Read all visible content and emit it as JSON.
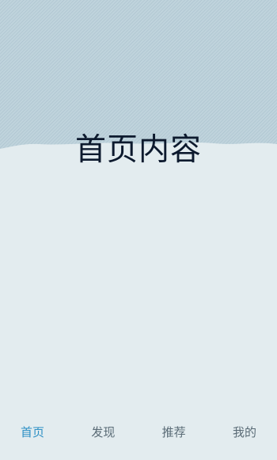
{
  "main": {
    "title": "首页内容"
  },
  "tab_bar": {
    "tabs": [
      {
        "label": "首页",
        "active": true
      },
      {
        "label": "发现",
        "active": false
      },
      {
        "label": "推荐",
        "active": false
      },
      {
        "label": "我的",
        "active": false
      }
    ]
  },
  "colors": {
    "accent": "#2c8fc4",
    "background": "#e3ecef",
    "header_texture": "#b9ced8"
  }
}
